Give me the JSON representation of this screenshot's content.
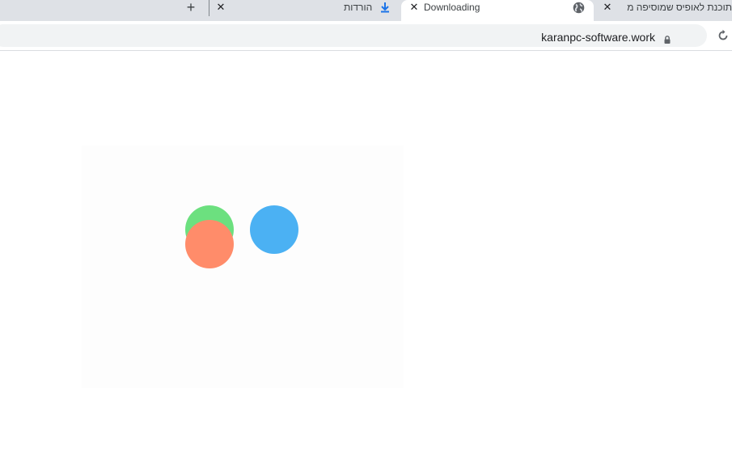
{
  "browser": {
    "tabs": [
      {
        "title": "תוכנת לאופיס שמוסיפה מ",
        "icon": "globe-icon",
        "active": false
      },
      {
        "title": "Downloading",
        "icon": "none",
        "active": true
      },
      {
        "title": "הורדות",
        "icon": "download-icon",
        "active": false
      }
    ],
    "new_tab_label": "+",
    "close_label": "✕",
    "address_bar": {
      "url": "karanpc-software.work",
      "secure": true
    }
  },
  "page": {
    "loader": {
      "dots": [
        {
          "name": "green",
          "color": "#6ce07f"
        },
        {
          "name": "orange",
          "color": "#ff8c6a"
        },
        {
          "name": "blue",
          "color": "#4bb1f3"
        }
      ],
      "background": "#fdfdfd"
    }
  },
  "colors": {
    "tabstrip": "#dee1e6",
    "omnibox": "#f1f3f4",
    "download_accent": "#1a73e8"
  }
}
